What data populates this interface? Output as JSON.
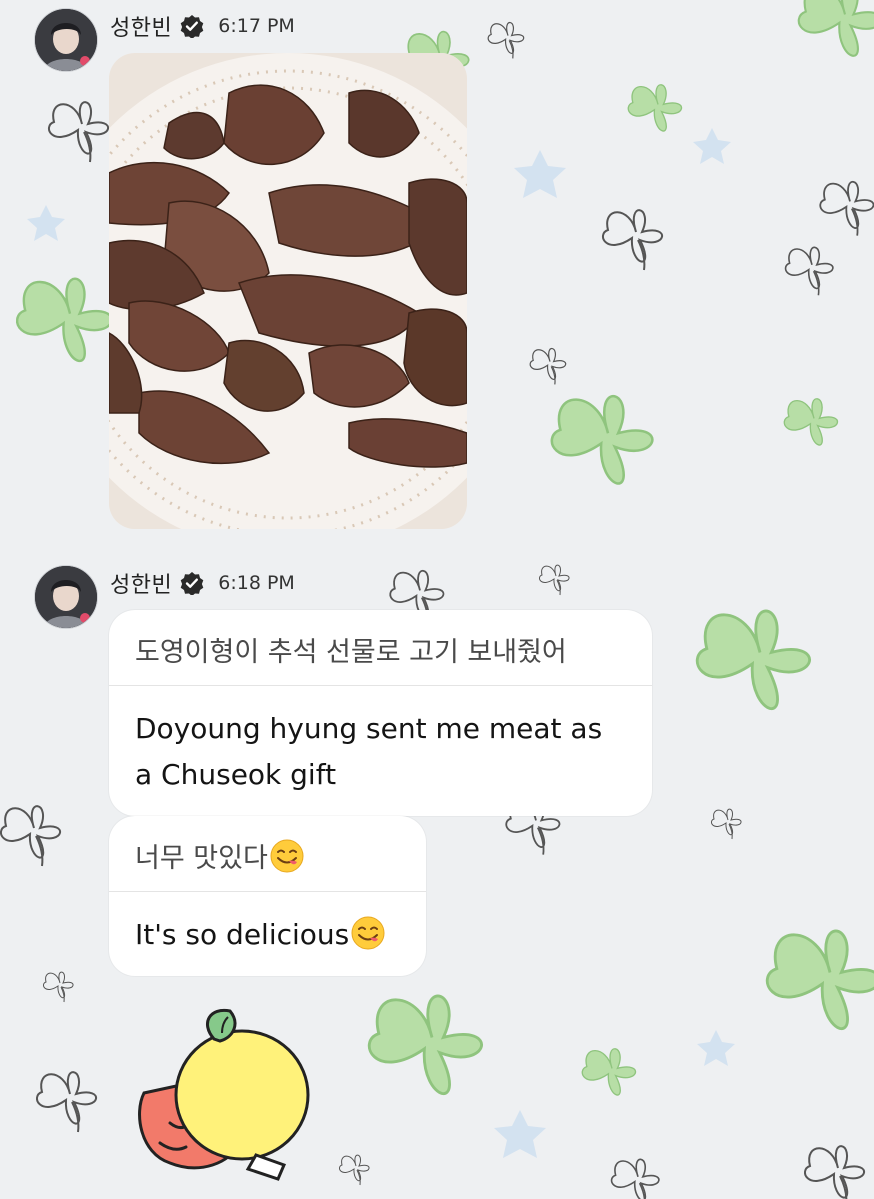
{
  "messages": [
    {
      "sender": "성한빈",
      "time": "6:17 PM",
      "type": "image",
      "image_desc": "plate-of-grilled-beef"
    },
    {
      "sender": "성한빈",
      "time": "6:18 PM",
      "type": "text",
      "bubbles": [
        {
          "ko": "도영이형이 추석 선물로 고기 보내줬어",
          "en": "Doyoung hyung sent me meat as a Chuseok gift"
        },
        {
          "ko": "너무 맛있다",
          "en": "It's so delicious",
          "emoji": "yum-face-emoji"
        }
      ]
    },
    {
      "type": "sticker",
      "sticker": "lemon-character-sticker"
    }
  ],
  "colors": {
    "background": "#eef0f2",
    "clover": "#a8d49a",
    "bubble": "#ffffff",
    "verified": "#2a2a2a"
  }
}
